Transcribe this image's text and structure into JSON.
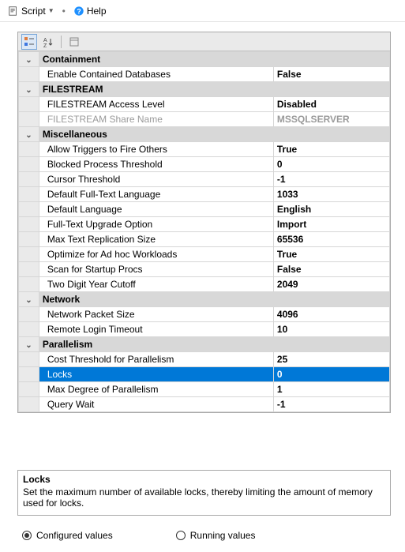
{
  "toolbar": {
    "script_label": "Script",
    "help_label": "Help"
  },
  "categories": [
    {
      "name": "Containment",
      "rows": [
        {
          "label": "Enable Contained Databases",
          "value": "False"
        }
      ]
    },
    {
      "name": "FILESTREAM",
      "rows": [
        {
          "label": "FILESTREAM Access Level",
          "value": "Disabled"
        },
        {
          "label": "FILESTREAM Share Name",
          "value": "MSSQLSERVER",
          "disabled": true
        }
      ]
    },
    {
      "name": "Miscellaneous",
      "rows": [
        {
          "label": "Allow Triggers to Fire Others",
          "value": "True"
        },
        {
          "label": "Blocked Process Threshold",
          "value": "0"
        },
        {
          "label": "Cursor Threshold",
          "value": "-1"
        },
        {
          "label": "Default Full-Text Language",
          "value": "1033"
        },
        {
          "label": "Default Language",
          "value": "English"
        },
        {
          "label": "Full-Text Upgrade Option",
          "value": "Import"
        },
        {
          "label": "Max Text Replication Size",
          "value": "65536"
        },
        {
          "label": "Optimize for Ad hoc Workloads",
          "value": "True"
        },
        {
          "label": "Scan for Startup Procs",
          "value": "False"
        },
        {
          "label": "Two Digit Year Cutoff",
          "value": "2049"
        }
      ]
    },
    {
      "name": "Network",
      "rows": [
        {
          "label": "Network Packet Size",
          "value": "4096"
        },
        {
          "label": "Remote Login Timeout",
          "value": "10"
        }
      ]
    },
    {
      "name": "Parallelism",
      "rows": [
        {
          "label": "Cost Threshold for Parallelism",
          "value": "25"
        },
        {
          "label": "Locks",
          "value": "0",
          "selected": true
        },
        {
          "label": "Max Degree of Parallelism",
          "value": "1"
        },
        {
          "label": "Query Wait",
          "value": "-1"
        }
      ]
    }
  ],
  "description": {
    "title": "Locks",
    "text": "Set the maximum number of available locks, thereby limiting the amount of memory used for locks."
  },
  "radios": {
    "configured": "Configured values",
    "running": "Running values",
    "selected": "configured"
  }
}
